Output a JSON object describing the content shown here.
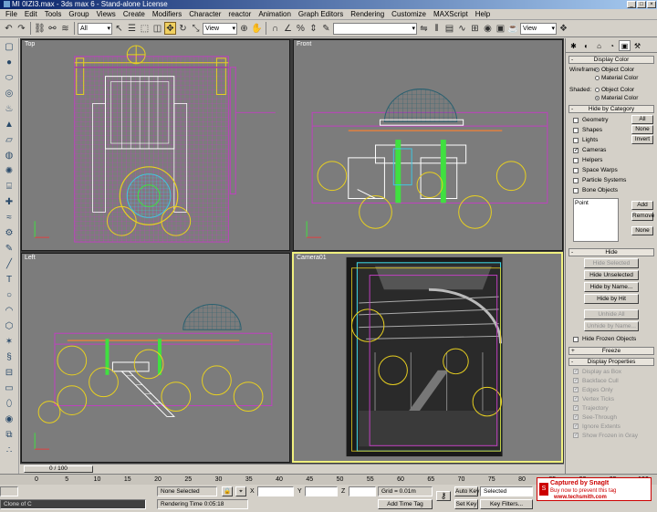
{
  "window": {
    "title": "MI 0IZI3.max - 3ds max 6 - Stand-alone License",
    "buttons": [
      "_",
      "□",
      "×"
    ]
  },
  "menu": [
    "File",
    "Edit",
    "Tools",
    "Group",
    "Views",
    "Create",
    "Modifiers",
    "Character",
    "reactor",
    "Animation",
    "Graph Editors",
    "Rendering",
    "Customize",
    "MAXScript",
    "Help"
  ],
  "toolbar": {
    "filter_select": "All",
    "ref_coord_select": "View",
    "named_sel_select": "",
    "view_select_right": "View"
  },
  "viewports": {
    "top": "Top",
    "front": "Front",
    "left": "Left",
    "camera": "Camera01"
  },
  "command_panel": {
    "display_color": {
      "header": "Display Color",
      "wireframe_label": "Wireframe:",
      "shaded_label": "Shaded:",
      "object_color": "Object Color",
      "material_color": "Material Color"
    },
    "hide_by_category": {
      "header": "Hide by Category",
      "items": [
        {
          "label": "Geometry",
          "checked": false
        },
        {
          "label": "Shapes",
          "checked": false
        },
        {
          "label": "Lights",
          "checked": false
        },
        {
          "label": "Cameras",
          "checked": true
        },
        {
          "label": "Helpers",
          "checked": false
        },
        {
          "label": "Space Warps",
          "checked": false
        },
        {
          "label": "Particle Systems",
          "checked": false
        },
        {
          "label": "Bone Objects",
          "checked": false
        }
      ],
      "all": "All",
      "none": "None",
      "invert": "Invert",
      "list_item": "Point",
      "add": "Add",
      "remove": "Remove",
      "none2": "None"
    },
    "hide": {
      "header": "Hide",
      "hide_selected": "Hide Selected",
      "hide_unselected": "Hide Unselected",
      "hide_by_name": "Hide by Name...",
      "hide_by_hit": "Hide by Hit",
      "unhide_all": "Unhide All",
      "unhide_by_name": "Unhide by Name...",
      "hide_frozen": "Hide Frozen Objects"
    },
    "freeze": {
      "header": "Freeze"
    },
    "display_properties": {
      "header": "Display Properties",
      "items": [
        {
          "label": "Display as Box",
          "checked": true
        },
        {
          "label": "Backface Cull",
          "checked": true
        },
        {
          "label": "Edges Only",
          "checked": true
        },
        {
          "label": "Vertex Ticks",
          "checked": true
        },
        {
          "label": "Trajectory",
          "checked": true
        },
        {
          "label": "See-Through",
          "checked": true
        },
        {
          "label": "Ignore Extents",
          "checked": true
        },
        {
          "label": "Show Frozen in Gray",
          "checked": true
        }
      ]
    }
  },
  "time_slider": {
    "label": "0 / 100",
    "current": 0,
    "total": 100
  },
  "trackbar": {
    "ticks": [
      "0",
      "5",
      "10",
      "15",
      "20",
      "25",
      "30",
      "35",
      "40",
      "45",
      "50",
      "55",
      "60",
      "65",
      "70",
      "75",
      "80",
      "85",
      "90",
      "95",
      "100"
    ]
  },
  "status": {
    "script_listener": "Clone of C",
    "selection": "None Selected",
    "rendering_time": "Rendering Time 0:05:18",
    "x_label": "X",
    "y_label": "Y",
    "z_label": "Z",
    "grid": "Grid = 0.01m",
    "add_time_tag": "Add Time Tag",
    "auto_key": "Auto Key",
    "set_key": "Set Key",
    "selected": "Selected",
    "key_filters": "Key Filters..."
  },
  "watermark": {
    "line1": "Captured by SnagIt",
    "line2": "Buy now to prevent this tag",
    "line3": "www.techsmith.com"
  },
  "colors": {
    "viewport_bg": "#7c7c7c",
    "wire_magenta": "#c040c0",
    "wire_yellow": "#e8d020",
    "wire_cyan": "#40e0f0",
    "wire_green": "#40e040",
    "active_border": "#f0f080"
  }
}
